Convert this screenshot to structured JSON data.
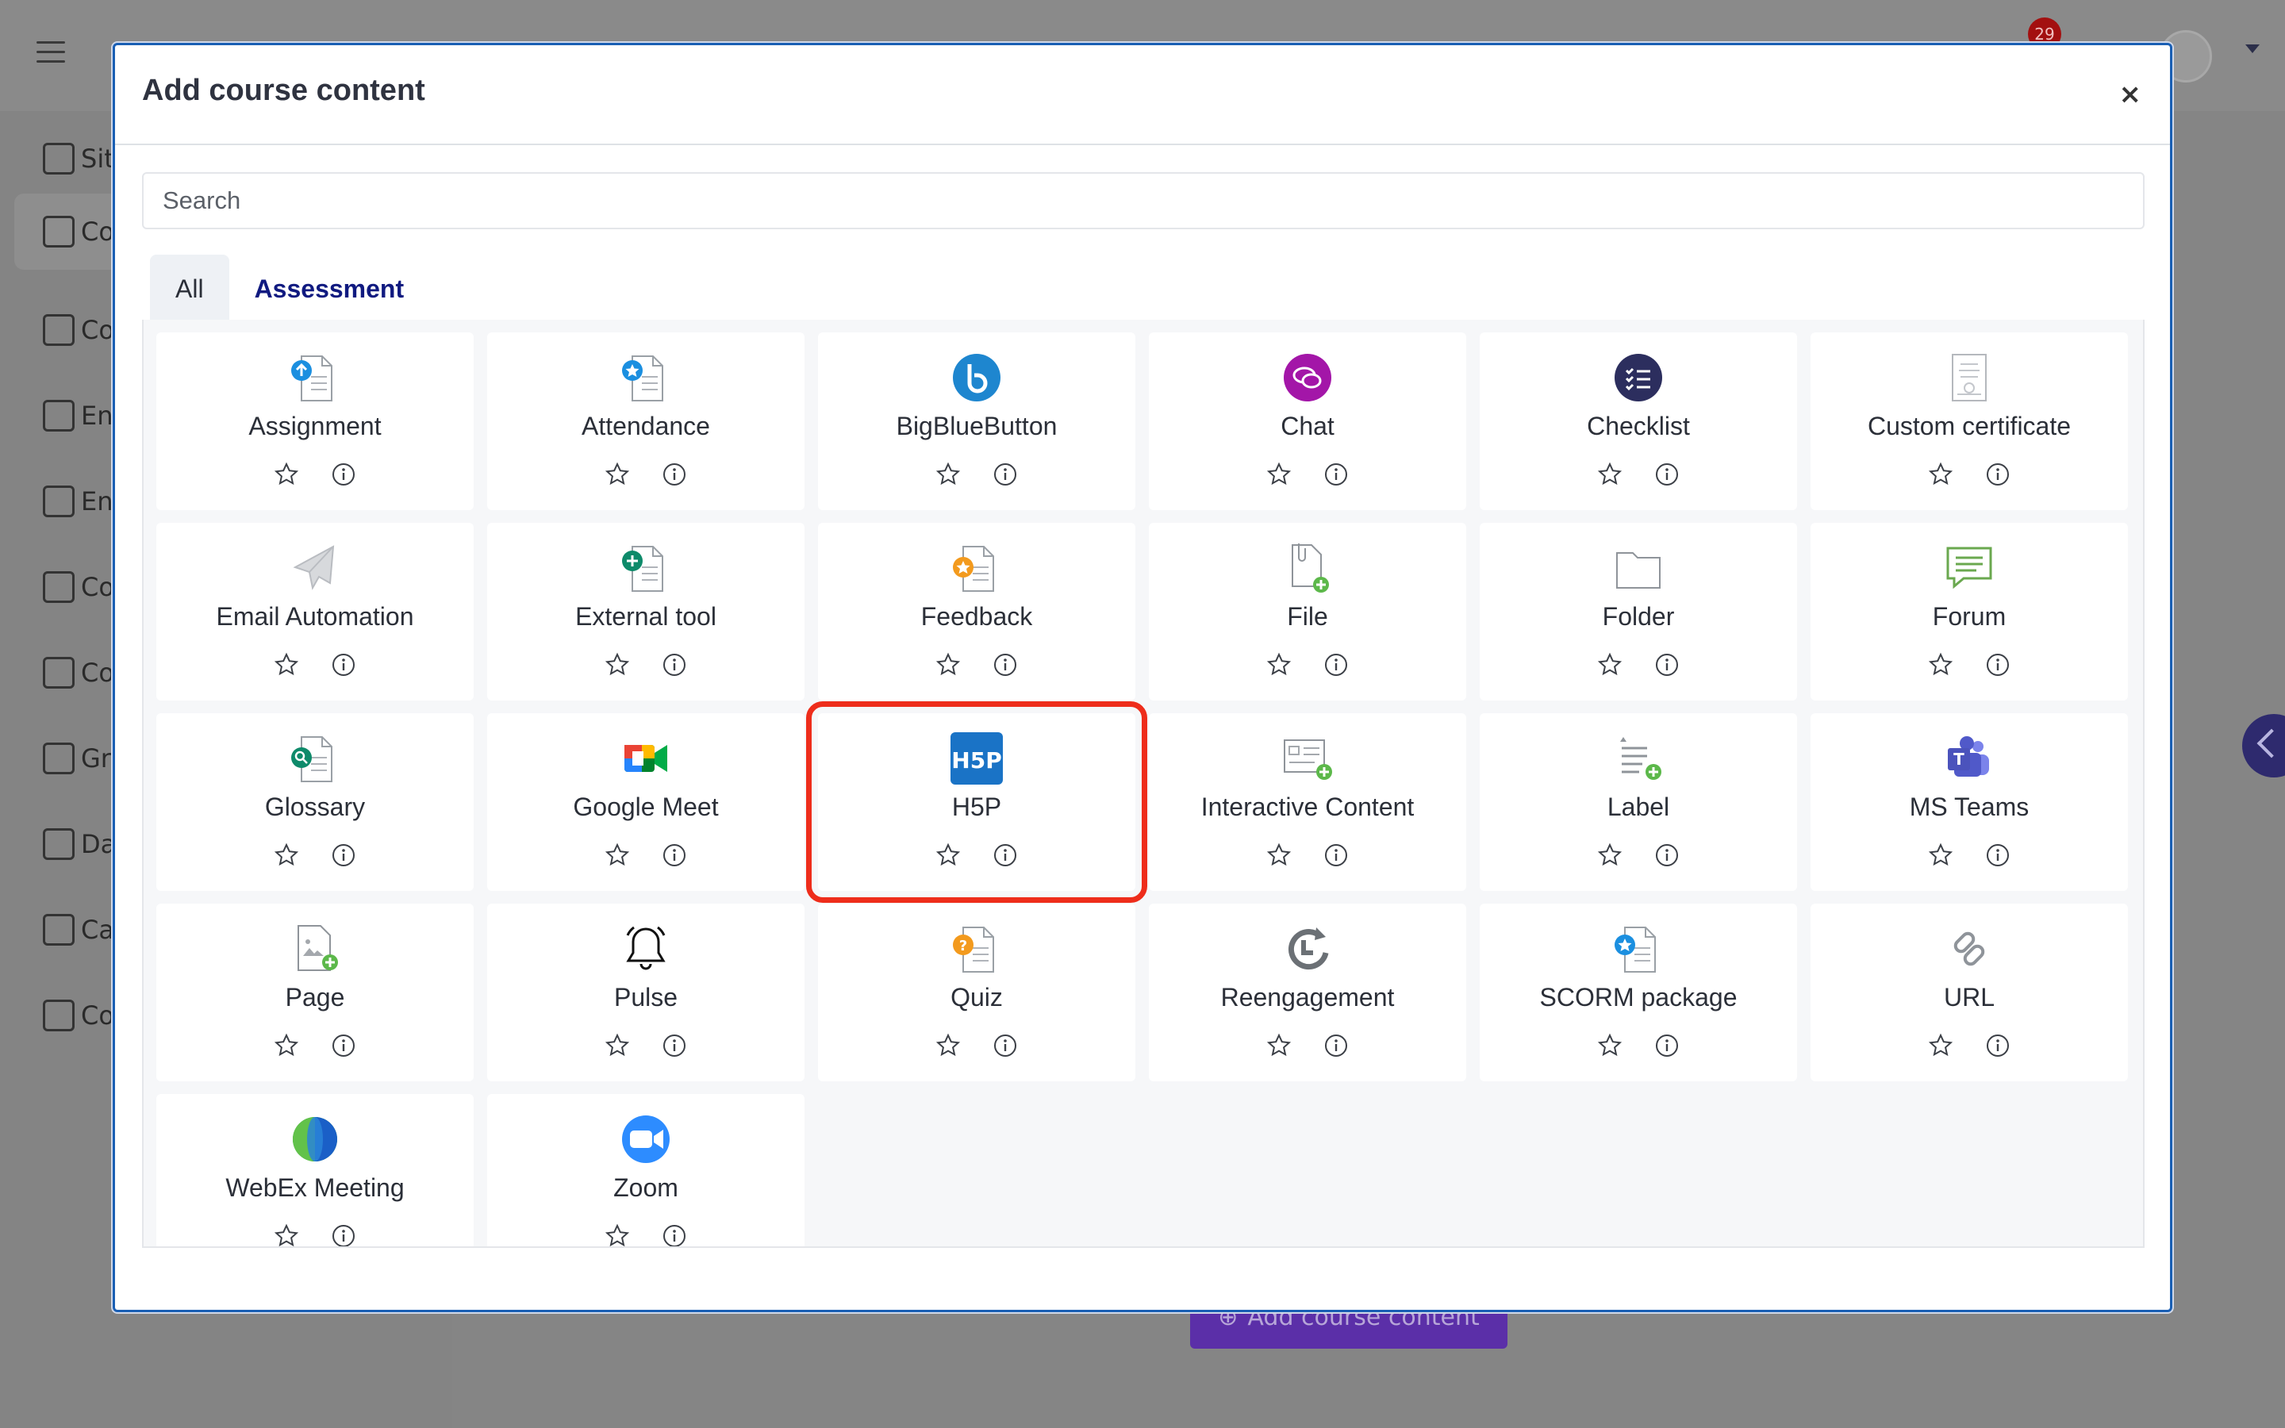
{
  "background": {
    "logo_text": "",
    "notification_count": "29",
    "sidebar_items": [
      {
        "label": "Sit",
        "icon": "home-icon"
      },
      {
        "label": "Co",
        "icon": "folder-icon"
      },
      {
        "label": "Co",
        "icon": "gear-icon"
      },
      {
        "label": "En",
        "icon": "user-icon"
      },
      {
        "label": "En",
        "icon": "users-icon"
      },
      {
        "label": "Co",
        "icon": "star-icon"
      },
      {
        "label": "Co",
        "icon": "clipboard-icon"
      },
      {
        "label": "Gr",
        "icon": "book-icon"
      },
      {
        "label": "Da",
        "icon": "dashboard-icon"
      },
      {
        "label": "Ca",
        "icon": "calendar-icon"
      },
      {
        "label": "Co",
        "icon": "folder-icon"
      }
    ],
    "add_button_label": "Add course content"
  },
  "modal": {
    "title": "Add course content",
    "close_label": "×",
    "search": {
      "placeholder": "Search"
    },
    "tabs": [
      {
        "label": "All",
        "active": true
      },
      {
        "label": "Assessment",
        "active": false
      }
    ],
    "highlighted_item": "H5P",
    "items": [
      {
        "label": "Assignment",
        "icon": "assignment-icon"
      },
      {
        "label": "Attendance",
        "icon": "attendance-icon"
      },
      {
        "label": "BigBlueButton",
        "icon": "bigbluebutton-icon"
      },
      {
        "label": "Chat",
        "icon": "chat-icon"
      },
      {
        "label": "Checklist",
        "icon": "checklist-icon"
      },
      {
        "label": "Custom certificate",
        "icon": "certificate-icon"
      },
      {
        "label": "Email Automation",
        "icon": "paper-plane-icon"
      },
      {
        "label": "External tool",
        "icon": "external-tool-icon"
      },
      {
        "label": "Feedback",
        "icon": "feedback-icon"
      },
      {
        "label": "File",
        "icon": "file-icon"
      },
      {
        "label": "Folder",
        "icon": "folder-icon"
      },
      {
        "label": "Forum",
        "icon": "forum-icon"
      },
      {
        "label": "Glossary",
        "icon": "glossary-icon"
      },
      {
        "label": "Google Meet",
        "icon": "google-meet-icon"
      },
      {
        "label": "H5P",
        "icon": "h5p-icon"
      },
      {
        "label": "Interactive Content",
        "icon": "interactive-content-icon"
      },
      {
        "label": "Label",
        "icon": "label-icon"
      },
      {
        "label": "MS Teams",
        "icon": "ms-teams-icon"
      },
      {
        "label": "Page",
        "icon": "page-icon"
      },
      {
        "label": "Pulse",
        "icon": "bell-icon"
      },
      {
        "label": "Quiz",
        "icon": "quiz-icon"
      },
      {
        "label": "Reengagement",
        "icon": "reengagement-icon"
      },
      {
        "label": "SCORM package",
        "icon": "scorm-icon"
      },
      {
        "label": "URL",
        "icon": "link-icon"
      },
      {
        "label": "WebEx Meeting",
        "icon": "webex-icon"
      },
      {
        "label": "Zoom",
        "icon": "zoom-icon"
      }
    ],
    "colors": {
      "accent_border": "#1a5fb4",
      "highlight": "#ee2d1b",
      "tab_link": "#101a80"
    }
  }
}
